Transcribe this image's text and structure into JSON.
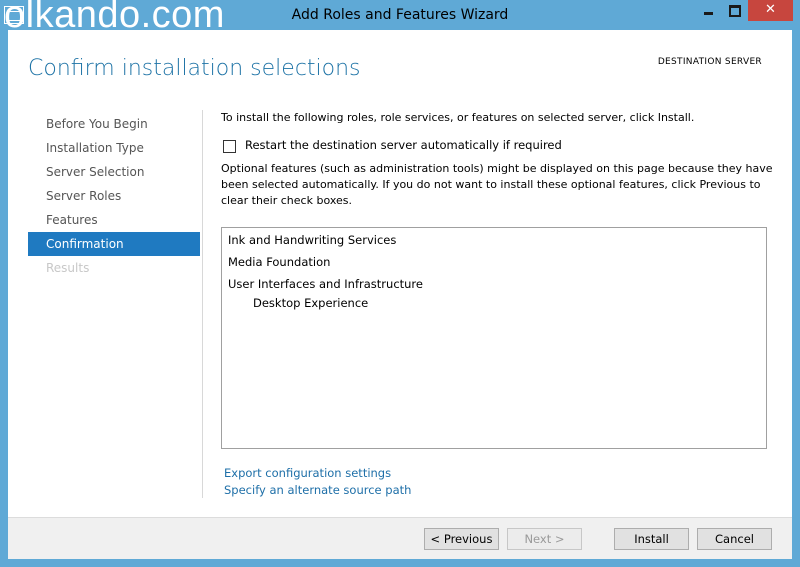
{
  "titlebar": {
    "title": "Add Roles and Features Wizard",
    "watermark": "olkando.com",
    "close_label": "✕"
  },
  "header": {
    "page_title": "Confirm installation selections",
    "destination_label": "DESTINATION SERVER"
  },
  "nav": {
    "items": [
      {
        "label": "Before You Begin"
      },
      {
        "label": "Installation Type"
      },
      {
        "label": "Server Selection"
      },
      {
        "label": "Server Roles"
      },
      {
        "label": "Features"
      },
      {
        "label": "Confirmation"
      },
      {
        "label": "Results"
      }
    ]
  },
  "main": {
    "intro": "To install the following roles, role services, or features on selected server, click Install.",
    "restart_label": "Restart the destination server automatically if required",
    "optional_note": "Optional features (such as administration tools) might be displayed on this page because they have been selected automatically. If you do not want to install these optional features, click Previous to clear their check boxes.",
    "features": [
      {
        "label": "Ink and Handwriting Services"
      },
      {
        "label": "Media Foundation"
      },
      {
        "label": "User Interfaces and Infrastructure"
      },
      {
        "label": "Desktop Experience"
      }
    ],
    "links": {
      "export": "Export configuration settings",
      "alternate_source": "Specify an alternate source path"
    }
  },
  "footer": {
    "previous": "< Previous",
    "next": "Next >",
    "install": "Install",
    "cancel": "Cancel"
  },
  "colors": {
    "accent": "#1f7ac1",
    "title_blue": "#1e73a6",
    "frame": "#5fa9d6",
    "close": "#c7463e"
  }
}
